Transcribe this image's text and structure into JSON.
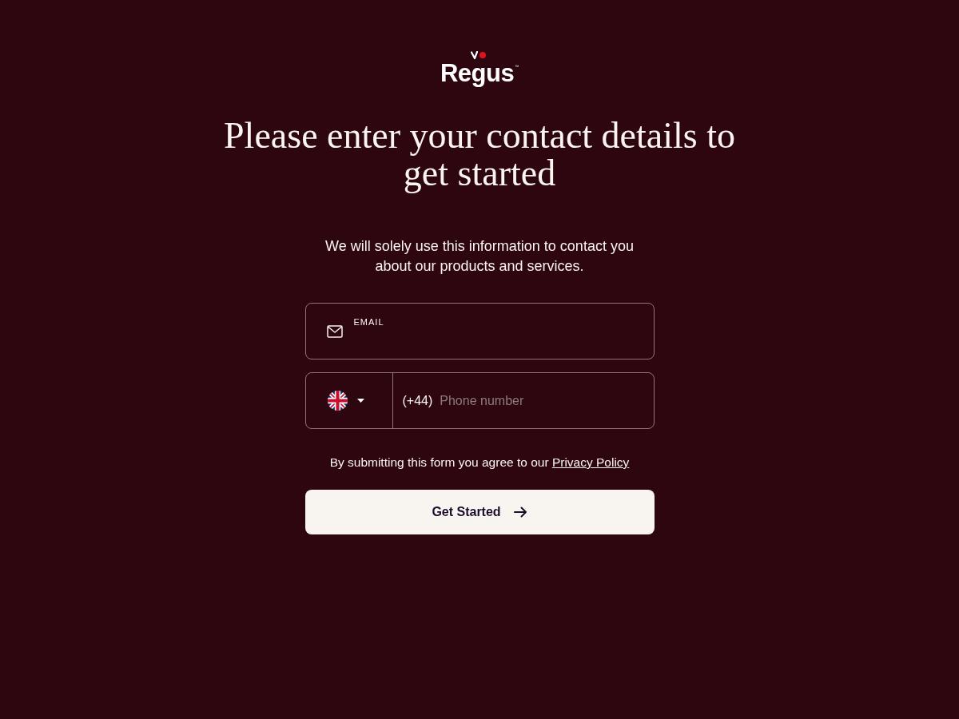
{
  "logo": {
    "wordmark": "Regus",
    "trademark": "™"
  },
  "heading": "Please enter your contact details to get started",
  "intro": "We will solely use this information to contact you about our products and services.",
  "email_field": {
    "label": "EMAIL"
  },
  "phone_field": {
    "country_code": "(+44)",
    "placeholder": "Phone number"
  },
  "consent": {
    "text": "By submitting this form you agree to our",
    "link": "Privacy Policy"
  },
  "submit_button": {
    "label": "Get Started"
  }
}
